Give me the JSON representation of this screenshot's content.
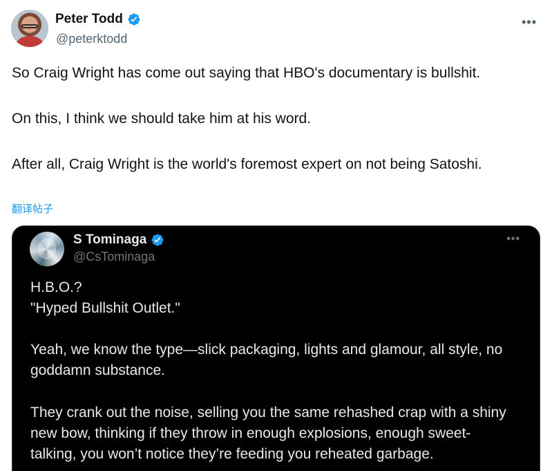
{
  "tweet": {
    "author_name": "Peter Todd",
    "handle": "@peterktodd",
    "more_icon": "more-dots-icon",
    "paragraphs": [
      "So Craig Wright has come out saying that HBO's documentary is bullshit.",
      "On this, I think we should take him at his word.",
      "After all, Craig Wright is the world's foremost expert on not being Satoshi."
    ],
    "translate_label": "翻译帖子",
    "accent_color": "#1d9bf0"
  },
  "quote": {
    "author_name": "S Tominaga",
    "handle": "@CsTominaga",
    "more_icon": "more-dots-icon",
    "lines": [
      "H.B.O.?",
      "\"Hyped Bullshit Outlet.\"",
      "Yeah, we know the type—slick packaging, lights and glamour, all style, no goddamn substance.",
      "They crank out the noise, selling you the same rehashed crap with a shiny new bow, thinking if they throw in enough explosions, enough sweet-talking, you won’t notice they’re feeding you reheated garbage."
    ],
    "background_color": "#000000"
  }
}
